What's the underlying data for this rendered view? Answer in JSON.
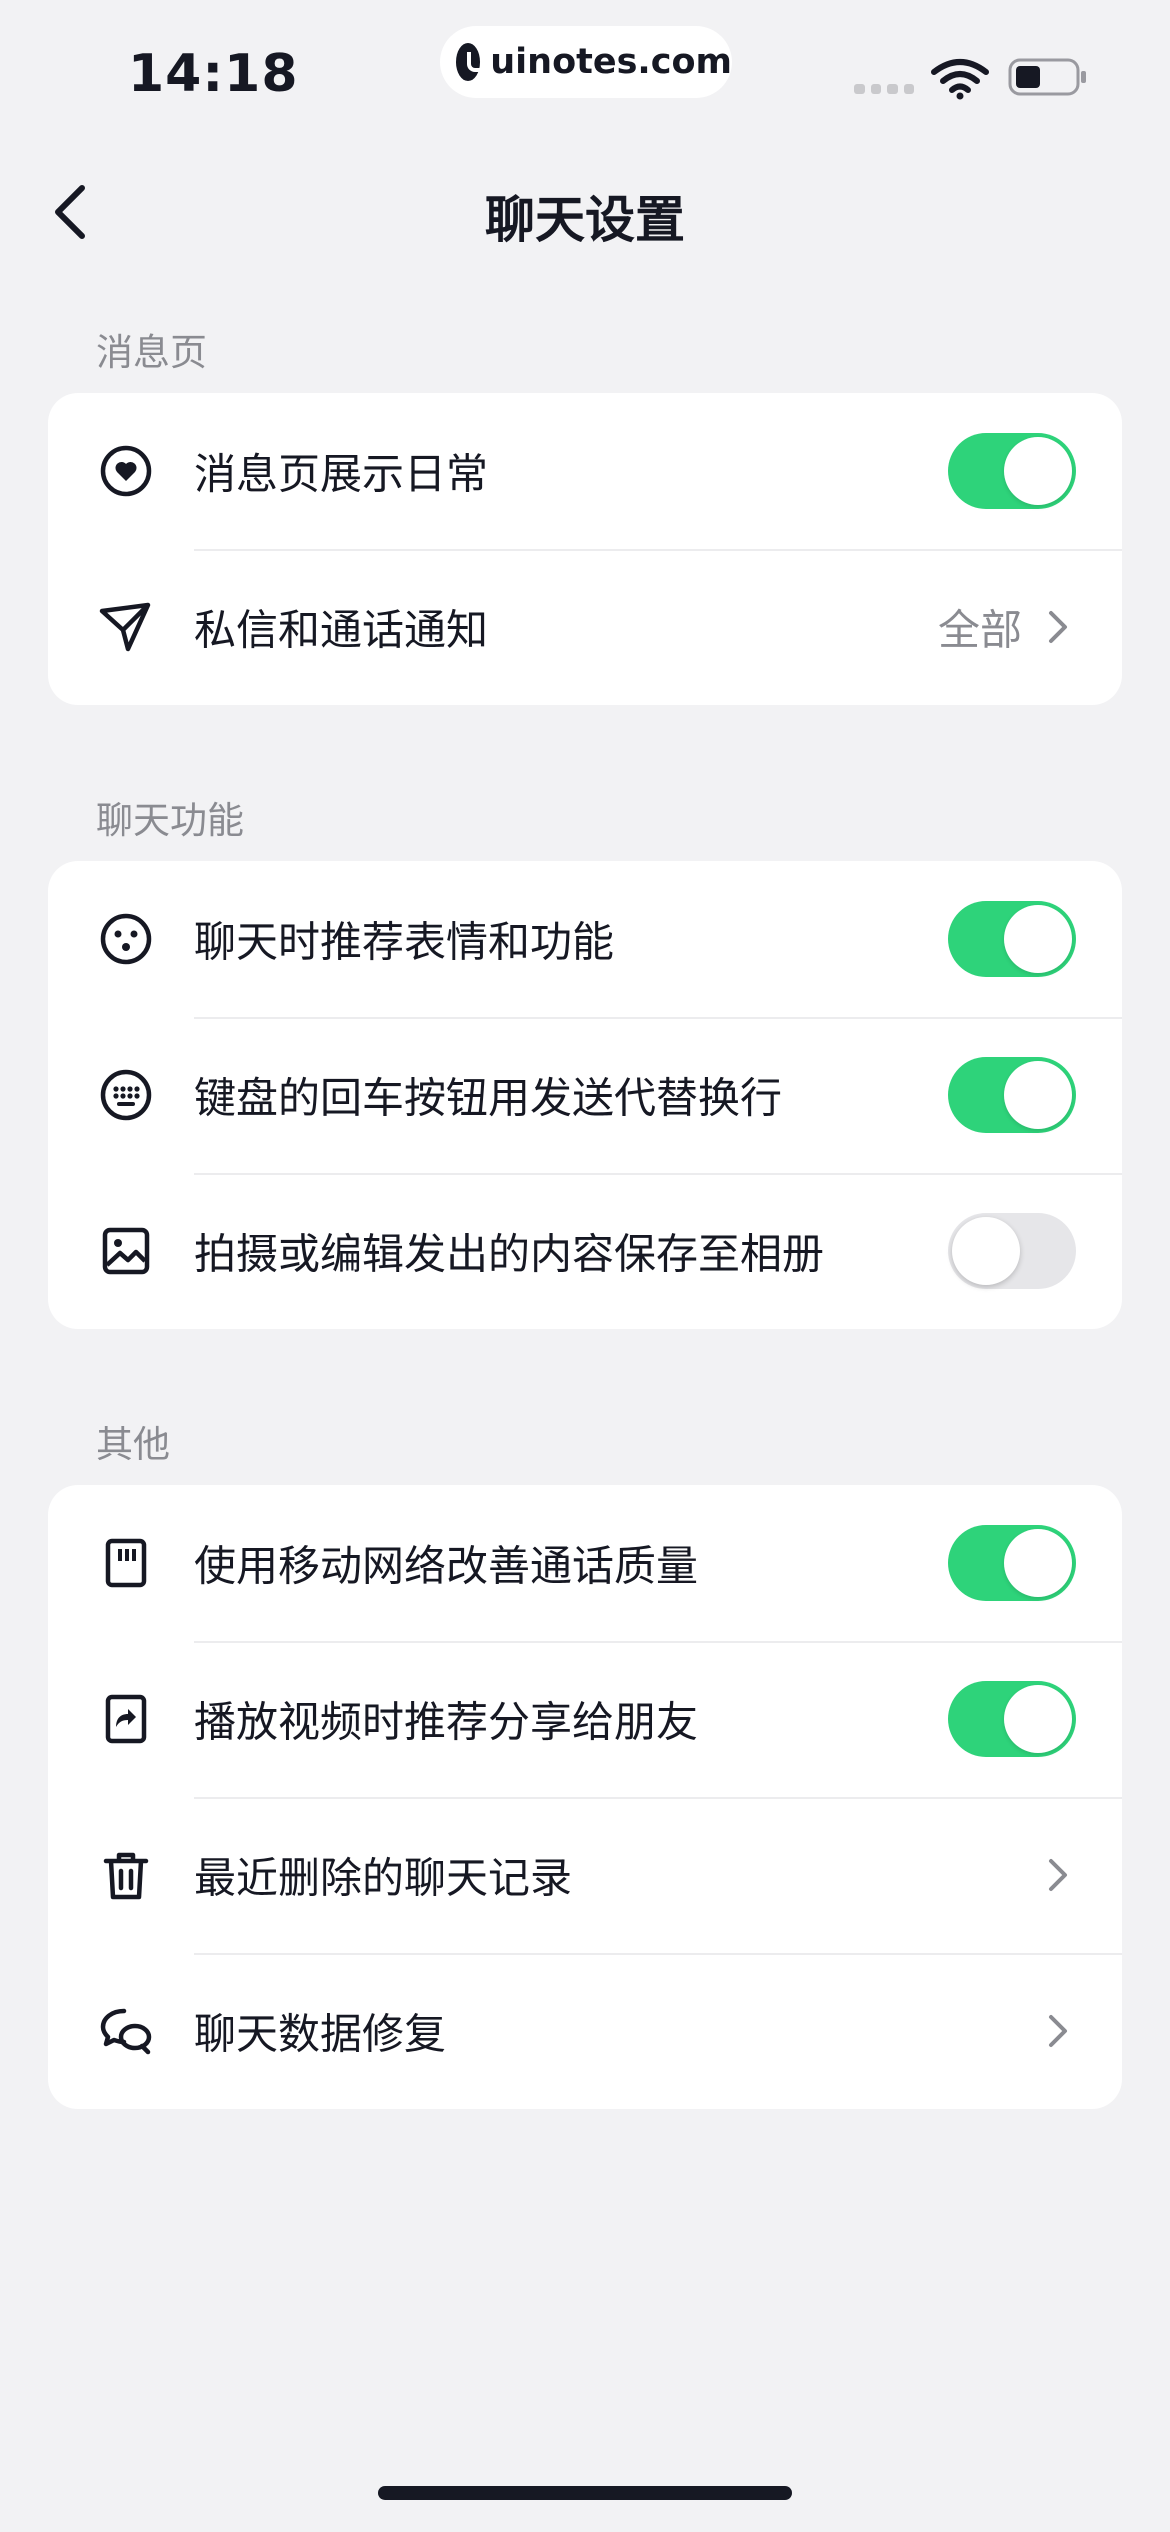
{
  "status_bar": {
    "time": "14:18",
    "watermark": "uinotes.com"
  },
  "nav": {
    "title": "聊天设置"
  },
  "sections": {
    "message_page": {
      "label": "消息页",
      "items": [
        {
          "label": "消息页展示日常",
          "icon": "heart-circle-icon",
          "toggle": true
        },
        {
          "label": "私信和通话通知",
          "icon": "send-icon",
          "value": "全部"
        }
      ]
    },
    "chat_features": {
      "label": "聊天功能",
      "items": [
        {
          "label": "聊天时推荐表情和功能",
          "icon": "smiley-icon",
          "toggle": true
        },
        {
          "label": "键盘的回车按钮用发送代替换行",
          "icon": "keyboard-icon",
          "toggle": true
        },
        {
          "label": "拍摄或编辑发出的内容保存至相册",
          "icon": "image-icon",
          "toggle": false
        }
      ]
    },
    "other": {
      "label": "其他",
      "items": [
        {
          "label": "使用移动网络改善通话质量",
          "icon": "sim-card-icon",
          "toggle": true
        },
        {
          "label": "播放视频时推荐分享给朋友",
          "icon": "share-icon",
          "toggle": true
        },
        {
          "label": "最近删除的聊天记录",
          "icon": "trash-icon"
        },
        {
          "label": "聊天数据修复",
          "icon": "chat-bubbles-icon"
        }
      ]
    }
  },
  "colors": {
    "background": "#f2f2f4",
    "card": "#ffffff",
    "toggle_on": "#2ed37a",
    "toggle_off": "#e6e6e9",
    "text_primary": "#161823",
    "text_secondary": "#8a8b91"
  }
}
